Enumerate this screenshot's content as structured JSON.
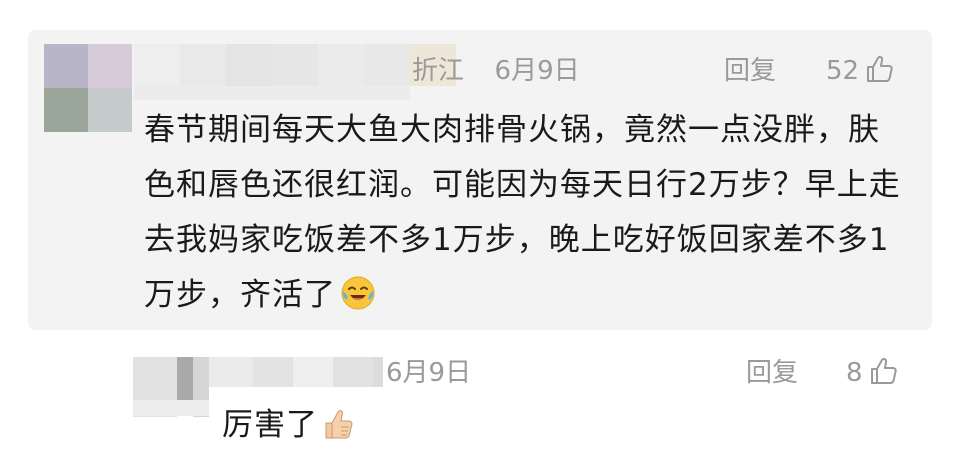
{
  "comment": {
    "location": "折江",
    "date": "6月9日",
    "reply_label": "回复",
    "like_count": "52",
    "text": "春节期间每天大鱼大肉排骨火锅，竟然一点没胖，肤色和唇色还很红润。可能因为每天日行2万步？早上走去我妈家吃饭差不多1万步，晚上吃好饭回家差不多1万步，齐活了",
    "emoji_icon": "laughing-tears-icon"
  },
  "reply": {
    "date": "6月9日",
    "reply_label": "回复",
    "like_count": "8",
    "text": "厉害了",
    "emoji_icon": "thumbs-up-icon"
  },
  "colors": {
    "card_bg": "#f3f3f3",
    "meta_gray": "#9a9a9a",
    "text_dark": "#1a1a1a"
  }
}
